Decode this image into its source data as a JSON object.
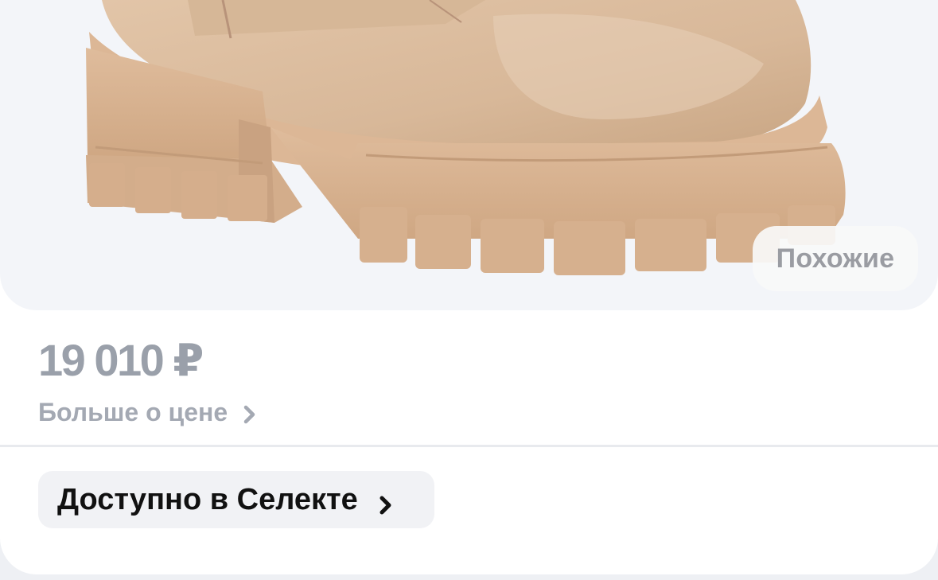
{
  "product": {
    "image": "beige-chunky-boot",
    "similar_label": "Похожие"
  },
  "price": {
    "amount": "19 010 ₽",
    "more_label": "Больше о цене"
  },
  "availability": {
    "label": "Доступно в Селекте"
  },
  "colors": {
    "boot": "#dcbfa2",
    "sole": "#d9b393",
    "image_background": "#f3f5f9",
    "price_text": "#9aa0aa"
  }
}
